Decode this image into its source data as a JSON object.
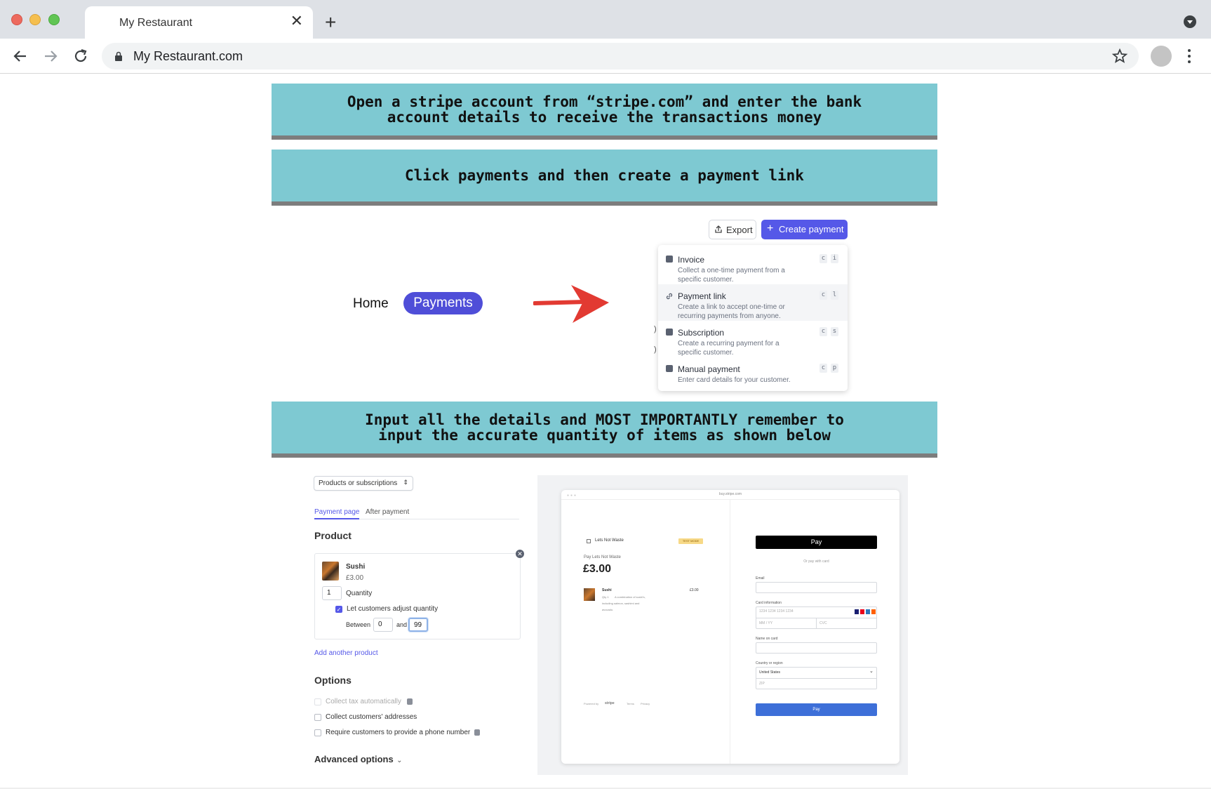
{
  "browser": {
    "tab_title": "My Restaurant",
    "url": "My Restaurant.com"
  },
  "banners": {
    "step1_line1": "Open a stripe account from “stripe.com” and enter the bank",
    "step1_line2": "account details to receive the transactions money",
    "step2": "Click payments and then create a payment link",
    "step3_line1": "Input all the details and MOST IMPORTANTLY remember to",
    "step3_line2": "input the accurate quantity of items as shown below"
  },
  "nav": {
    "home": "Home",
    "payments": "Payments"
  },
  "dashboard": {
    "export_label": "Export",
    "create_label": "Create payment",
    "menu": [
      {
        "title": "Invoice",
        "desc": "Collect a one-time payment from a specific customer.",
        "keys": [
          "c",
          "i"
        ]
      },
      {
        "title": "Payment link",
        "desc": "Create a link to accept one-time or recurring payments from anyone.",
        "keys": [
          "c",
          "l"
        ]
      },
      {
        "title": "Subscription",
        "desc": "Create a recurring payment for a specific customer.",
        "keys": [
          "c",
          "s"
        ]
      },
      {
        "title": "Manual payment",
        "desc": "Enter card details for your customer.",
        "keys": [
          "c",
          "p"
        ]
      }
    ]
  },
  "form": {
    "product_type": "Products or subscriptions",
    "tabs": [
      "Payment page",
      "After payment"
    ],
    "product_heading": "Product",
    "product_name": "Sushi",
    "product_price": "£3.00",
    "quantity_value": "1",
    "quantity_label": "Quantity",
    "adjust_label": "Let customers adjust quantity",
    "between_label": "Between",
    "and_label": "and",
    "min_value": "0",
    "max_value": "99",
    "add_product": "Add another product",
    "options_heading": "Options",
    "options": [
      {
        "label": "Collect tax automatically",
        "checked": false,
        "disabled": true
      },
      {
        "label": "Collect customers' addresses",
        "checked": false,
        "disabled": false
      },
      {
        "label": "Require customers to provide a phone number",
        "checked": false,
        "disabled": false
      }
    ],
    "advanced": "Advanced options"
  },
  "checkout": {
    "url": "buy.stripe.com",
    "merchant": "Lets Not Waste",
    "test_mode": "TEST MODE",
    "pay_label": "Pay Lets Not Waste",
    "amount": "£3.00",
    "item_name": "Sushi",
    "item_price": "£3.00",
    "item_qty": "Qty 1",
    "item_desc_1": "A combination of sushi's,",
    "item_desc_2": "including salmon, sashimi and",
    "item_desc_3": "avocado.",
    "apple_pay": " Pay",
    "or_card": "Or pay with card",
    "email_label": "Email",
    "card_label": "Card information",
    "card_placeholder": "1234 1234 1234 1234",
    "expiry_placeholder": "MM / YY",
    "cvc_placeholder": "CVC",
    "name_label": "Name on card",
    "country_label": "Country or region",
    "country_value": "United States",
    "zip_placeholder": "ZIP",
    "pay_button": "Pay",
    "powered_by": "Powered by",
    "stripe": "stripe",
    "terms": "Terms",
    "privacy": "Privacy"
  },
  "colors": {
    "banner_bg": "#7ec9d2",
    "banner_border": "#7d7d7d",
    "accent": "#5558e8",
    "pill": "#4f4ed8",
    "arrow": "#e23a32",
    "pay_button": "#3d6fd8"
  }
}
